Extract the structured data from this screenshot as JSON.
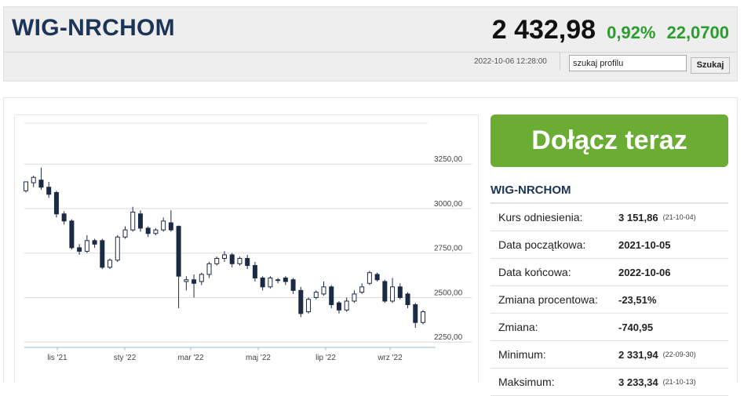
{
  "header": {
    "ticker": "WIG-NRCHOM",
    "price": "2 432,98",
    "change_pct": "0,92%",
    "change_abs": "22,0700",
    "timestamp": "2022-10-06 12:28:00"
  },
  "search": {
    "value": "szukaj profilu",
    "button_label": "Szukaj"
  },
  "cta": {
    "label": "Dołącz teraz"
  },
  "info": {
    "title": "WIG-NRCHOM",
    "rows": [
      {
        "label": "Kurs odniesienia:",
        "value": "3 151,86",
        "sub": "(21-10-04)"
      },
      {
        "label": "Data początkowa:",
        "value": "2021-10-05",
        "sub": ""
      },
      {
        "label": "Data końcowa:",
        "value": "2022-10-06",
        "sub": ""
      },
      {
        "label": "Zmiana procentowa:",
        "value": "-23,51%",
        "sub": ""
      },
      {
        "label": "Zmiana:",
        "value": "-740,95",
        "sub": ""
      },
      {
        "label": "Minimum:",
        "value": "2 331,94",
        "sub": "(22-09-30)"
      },
      {
        "label": "Maksimum:",
        "value": "3 233,34",
        "sub": "(21-10-13)"
      }
    ]
  },
  "colors": {
    "up": "#ffffff",
    "down": "#1b2a45",
    "accent_green": "#2a9d2e",
    "cta_bg": "#6aac34",
    "title_navy": "#1c3557"
  },
  "chart_data": {
    "type": "candlestick",
    "x_tick_labels": [
      "lis '21",
      "sty '22",
      "mar '22",
      "maj '22",
      "lip '22",
      "wrz '22"
    ],
    "y_tick_labels": [
      "3250,00",
      "3000,00",
      "2750,00",
      "2500,00",
      "2250,00"
    ],
    "y_ticks": [
      3250,
      3000,
      2750,
      2500,
      2250
    ],
    "ylim": [
      2220,
      3480
    ],
    "grid": true,
    "candles": [
      [
        3100,
        3150,
        3140,
        3090
      ],
      [
        3145,
        3175,
        3185,
        3120
      ],
      [
        3160,
        3120,
        3230,
        3105
      ],
      [
        3120,
        3080,
        3150,
        3060
      ],
      [
        3090,
        2970,
        3100,
        2950
      ],
      [
        2970,
        2930,
        2985,
        2910
      ],
      [
        2930,
        2780,
        2940,
        2770
      ],
      [
        2780,
        2760,
        2800,
        2740
      ],
      [
        2760,
        2820,
        2850,
        2750
      ],
      [
        2820,
        2800,
        2830,
        2780
      ],
      [
        2820,
        2670,
        2830,
        2660
      ],
      [
        2670,
        2710,
        2720,
        2660
      ],
      [
        2710,
        2840,
        2850,
        2700
      ],
      [
        2840,
        2880,
        2900,
        2830
      ],
      [
        2880,
        2980,
        3010,
        2870
      ],
      [
        2970,
        2890,
        2990,
        2870
      ],
      [
        2890,
        2860,
        2900,
        2840
      ],
      [
        2860,
        2880,
        2890,
        2850
      ],
      [
        2880,
        2930,
        2950,
        2870
      ],
      [
        2920,
        2880,
        2990,
        2870
      ],
      [
        2900,
        2620,
        2905,
        2440
      ],
      [
        2590,
        2600,
        2620,
        2540
      ],
      [
        2600,
        2580,
        2630,
        2500
      ],
      [
        2590,
        2630,
        2640,
        2570
      ],
      [
        2630,
        2690,
        2700,
        2610
      ],
      [
        2690,
        2720,
        2730,
        2680
      ],
      [
        2720,
        2740,
        2760,
        2700
      ],
      [
        2740,
        2690,
        2750,
        2670
      ],
      [
        2690,
        2720,
        2730,
        2680
      ],
      [
        2720,
        2680,
        2740,
        2660
      ],
      [
        2680,
        2610,
        2700,
        2590
      ],
      [
        2610,
        2560,
        2620,
        2540
      ],
      [
        2560,
        2610,
        2620,
        2550
      ],
      [
        2600,
        2600,
        2610,
        2580
      ],
      [
        2610,
        2590,
        2620,
        2570
      ],
      [
        2600,
        2540,
        2610,
        2520
      ],
      [
        2540,
        2410,
        2560,
        2390
      ],
      [
        2420,
        2490,
        2500,
        2410
      ],
      [
        2500,
        2530,
        2540,
        2490
      ],
      [
        2520,
        2560,
        2590,
        2510
      ],
      [
        2560,
        2460,
        2570,
        2440
      ],
      [
        2470,
        2430,
        2480,
        2410
      ],
      [
        2430,
        2480,
        2500,
        2420
      ],
      [
        2480,
        2520,
        2540,
        2470
      ],
      [
        2530,
        2560,
        2580,
        2520
      ],
      [
        2580,
        2640,
        2650,
        2570
      ],
      [
        2630,
        2600,
        2640,
        2590
      ],
      [
        2590,
        2480,
        2600,
        2470
      ],
      [
        2480,
        2560,
        2610,
        2470
      ],
      [
        2560,
        2500,
        2580,
        2490
      ],
      [
        2520,
        2460,
        2530,
        2440
      ],
      [
        2460,
        2360,
        2470,
        2330
      ],
      [
        2360,
        2420,
        2430,
        2350
      ]
    ]
  }
}
